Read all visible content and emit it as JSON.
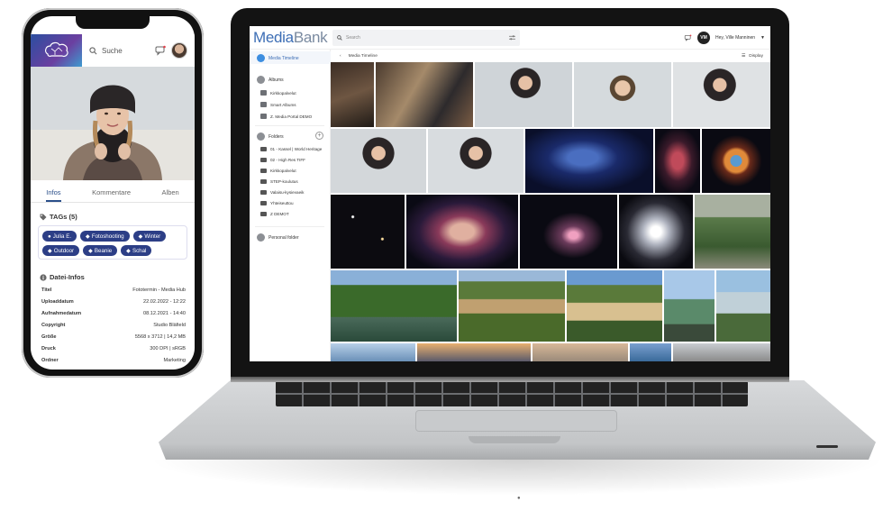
{
  "phone": {
    "search_label": "Suche",
    "tabs": [
      "Infos",
      "Kommentare",
      "Alben"
    ],
    "tags_title": "TAGs (5)",
    "tags": [
      "Julia E.",
      "Fotoshooting",
      "Winter",
      "Outdoor",
      "Beanie",
      "Schal"
    ],
    "info_title": "Datei-Infos",
    "info_rows": [
      {
        "k": "Titel",
        "v": "Fototermin - Media Hub"
      },
      {
        "k": "Uploaddatum",
        "v": "22.02.2022 - 12:22"
      },
      {
        "k": "Aufnahmedatum",
        "v": "08.12.2021 - 14:40"
      },
      {
        "k": "Copyright",
        "v": "Studio Bläfield"
      },
      {
        "k": "Größe",
        "v": "5568 x 3712 | 14,2 MB"
      },
      {
        "k": "Druck",
        "v": "300 DPI | sRGB"
      },
      {
        "k": "Ordner",
        "v": "Marketing"
      }
    ]
  },
  "app": {
    "brand_a": "Media",
    "brand_b": "Bank",
    "search_placeholder": "Search",
    "user_initials": "VM",
    "user_name": "Hey, Ville Manninen",
    "breadcrumb": "Media Timeline",
    "display_label": "Display",
    "sidebar": {
      "timeline": "Media Timeline",
      "albums": "Albums",
      "album_items": [
        "Kirkkopalvelut",
        "Smart Albums",
        "Z. Media Portal DEMO"
      ],
      "folders": "Folders",
      "folder_items": [
        "01 - Kassel | World Heritage",
        "02 - High Res TIFF",
        "Kirkkopalvelut",
        "STEP-koulutus",
        "Valaisu-kysievaeik",
        "Yhteiseuttou",
        "Z DEMOT"
      ],
      "personal": "Personal folder"
    }
  },
  "colors": {
    "brand": "#3d6eb5",
    "tag_bg": "#2c3e86",
    "active_tab": "#2b4f8a"
  }
}
